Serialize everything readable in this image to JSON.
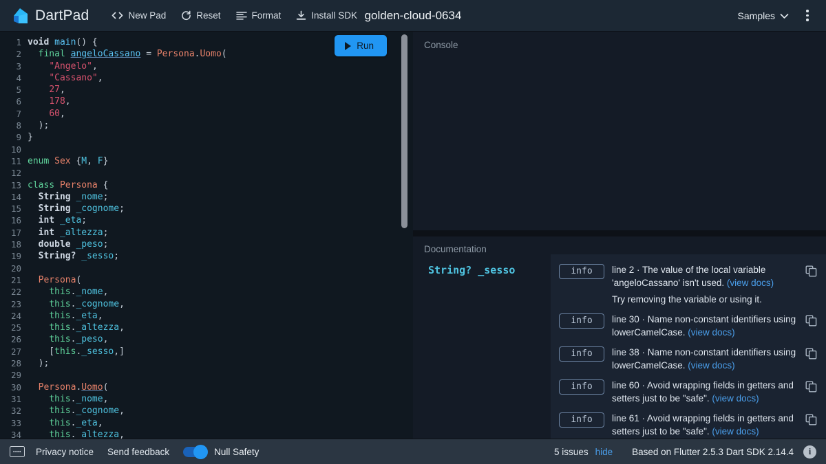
{
  "header": {
    "brand": "DartPad",
    "brand_icon": "dart-logo-icon",
    "buttons": [
      {
        "label": "New Pad",
        "icon": "code-brackets-icon"
      },
      {
        "label": "Reset",
        "icon": "refresh-icon"
      },
      {
        "label": "Format",
        "icon": "format-align-icon"
      },
      {
        "label": "Install SDK",
        "icon": "download-icon"
      }
    ],
    "pad_title": "golden-cloud-0634",
    "samples_label": "Samples",
    "samples_icon": "chevron-down-icon",
    "overflow_icon": "kebab-menu-icon"
  },
  "editor": {
    "run_label": "Run",
    "run_icon": "play-icon",
    "lines": [
      {
        "n": 1,
        "tokens": [
          {
            "t": "void ",
            "c": "kw"
          },
          {
            "t": "main",
            "c": "fn"
          },
          {
            "t": "() {",
            "c": "pun"
          }
        ]
      },
      {
        "n": 2,
        "tokens": [
          {
            "t": "  ",
            "c": "pun"
          },
          {
            "t": "final ",
            "c": "kw2"
          },
          {
            "t": "angeloCassano",
            "c": "fn un"
          },
          {
            "t": " = ",
            "c": "pun"
          },
          {
            "t": "Persona",
            "c": "typ"
          },
          {
            "t": ".",
            "c": "pun"
          },
          {
            "t": "Uomo",
            "c": "typ"
          },
          {
            "t": "(",
            "c": "pun"
          }
        ]
      },
      {
        "n": 3,
        "tokens": [
          {
            "t": "    ",
            "c": "pun"
          },
          {
            "t": "\"Angelo\"",
            "c": "str"
          },
          {
            "t": ",",
            "c": "pun"
          }
        ]
      },
      {
        "n": 4,
        "tokens": [
          {
            "t": "    ",
            "c": "pun"
          },
          {
            "t": "\"Cassano\"",
            "c": "str"
          },
          {
            "t": ",",
            "c": "pun"
          }
        ]
      },
      {
        "n": 5,
        "tokens": [
          {
            "t": "    ",
            "c": "pun"
          },
          {
            "t": "27",
            "c": "num"
          },
          {
            "t": ",",
            "c": "pun"
          }
        ]
      },
      {
        "n": 6,
        "tokens": [
          {
            "t": "    ",
            "c": "pun"
          },
          {
            "t": "178",
            "c": "num"
          },
          {
            "t": ",",
            "c": "pun"
          }
        ]
      },
      {
        "n": 7,
        "tokens": [
          {
            "t": "    ",
            "c": "pun"
          },
          {
            "t": "60",
            "c": "num"
          },
          {
            "t": ",",
            "c": "pun"
          }
        ]
      },
      {
        "n": 8,
        "tokens": [
          {
            "t": "  );",
            "c": "pun"
          }
        ]
      },
      {
        "n": 9,
        "tokens": [
          {
            "t": "}",
            "c": "pun"
          }
        ]
      },
      {
        "n": 10,
        "tokens": []
      },
      {
        "n": 11,
        "tokens": [
          {
            "t": "enum ",
            "c": "kw2"
          },
          {
            "t": "Sex ",
            "c": "typ"
          },
          {
            "t": "{",
            "c": "pun"
          },
          {
            "t": "M",
            "c": "fld"
          },
          {
            "t": ", ",
            "c": "pun"
          },
          {
            "t": "F",
            "c": "fld"
          },
          {
            "t": "}",
            "c": "pun"
          }
        ]
      },
      {
        "n": 12,
        "tokens": []
      },
      {
        "n": 13,
        "tokens": [
          {
            "t": "class ",
            "c": "kw2"
          },
          {
            "t": "Persona ",
            "c": "typ"
          },
          {
            "t": "{",
            "c": "pun"
          }
        ]
      },
      {
        "n": 14,
        "tokens": [
          {
            "t": "  ",
            "c": "pun"
          },
          {
            "t": "String",
            "c": "kw"
          },
          {
            "t": " ",
            "c": "pun"
          },
          {
            "t": "_nome",
            "c": "fld"
          },
          {
            "t": ";",
            "c": "pun"
          }
        ]
      },
      {
        "n": 15,
        "tokens": [
          {
            "t": "  ",
            "c": "pun"
          },
          {
            "t": "String",
            "c": "kw"
          },
          {
            "t": " ",
            "c": "pun"
          },
          {
            "t": "_cognome",
            "c": "fld"
          },
          {
            "t": ";",
            "c": "pun"
          }
        ]
      },
      {
        "n": 16,
        "tokens": [
          {
            "t": "  ",
            "c": "pun"
          },
          {
            "t": "int",
            "c": "kw"
          },
          {
            "t": " ",
            "c": "pun"
          },
          {
            "t": "_eta",
            "c": "fld"
          },
          {
            "t": ";",
            "c": "pun"
          }
        ]
      },
      {
        "n": 17,
        "tokens": [
          {
            "t": "  ",
            "c": "pun"
          },
          {
            "t": "int",
            "c": "kw"
          },
          {
            "t": " ",
            "c": "pun"
          },
          {
            "t": "_altezza",
            "c": "fld"
          },
          {
            "t": ";",
            "c": "pun"
          }
        ]
      },
      {
        "n": 18,
        "tokens": [
          {
            "t": "  ",
            "c": "pun"
          },
          {
            "t": "double",
            "c": "kw"
          },
          {
            "t": " ",
            "c": "pun"
          },
          {
            "t": "_peso",
            "c": "fld"
          },
          {
            "t": ";",
            "c": "pun"
          }
        ]
      },
      {
        "n": 19,
        "tokens": [
          {
            "t": "  ",
            "c": "pun"
          },
          {
            "t": "String?",
            "c": "kw"
          },
          {
            "t": " ",
            "c": "pun"
          },
          {
            "t": "_sesso",
            "c": "fld"
          },
          {
            "t": ";",
            "c": "pun"
          }
        ]
      },
      {
        "n": 20,
        "tokens": []
      },
      {
        "n": 21,
        "tokens": [
          {
            "t": "  ",
            "c": "pun"
          },
          {
            "t": "Persona",
            "c": "typ"
          },
          {
            "t": "(",
            "c": "pun"
          }
        ]
      },
      {
        "n": 22,
        "tokens": [
          {
            "t": "    ",
            "c": "pun"
          },
          {
            "t": "this",
            "c": "this"
          },
          {
            "t": ".",
            "c": "pun"
          },
          {
            "t": "_nome",
            "c": "fld"
          },
          {
            "t": ",",
            "c": "pun"
          }
        ]
      },
      {
        "n": 23,
        "tokens": [
          {
            "t": "    ",
            "c": "pun"
          },
          {
            "t": "this",
            "c": "this"
          },
          {
            "t": ".",
            "c": "pun"
          },
          {
            "t": "_cognome",
            "c": "fld"
          },
          {
            "t": ",",
            "c": "pun"
          }
        ]
      },
      {
        "n": 24,
        "tokens": [
          {
            "t": "    ",
            "c": "pun"
          },
          {
            "t": "this",
            "c": "this"
          },
          {
            "t": ".",
            "c": "pun"
          },
          {
            "t": "_eta",
            "c": "fld"
          },
          {
            "t": ",",
            "c": "pun"
          }
        ]
      },
      {
        "n": 25,
        "tokens": [
          {
            "t": "    ",
            "c": "pun"
          },
          {
            "t": "this",
            "c": "this"
          },
          {
            "t": ".",
            "c": "pun"
          },
          {
            "t": "_altezza",
            "c": "fld"
          },
          {
            "t": ",",
            "c": "pun"
          }
        ]
      },
      {
        "n": 26,
        "tokens": [
          {
            "t": "    ",
            "c": "pun"
          },
          {
            "t": "this",
            "c": "this"
          },
          {
            "t": ".",
            "c": "pun"
          },
          {
            "t": "_peso",
            "c": "fld"
          },
          {
            "t": ",",
            "c": "pun"
          }
        ]
      },
      {
        "n": 27,
        "tokens": [
          {
            "t": "    [",
            "c": "pun"
          },
          {
            "t": "this",
            "c": "this"
          },
          {
            "t": ".",
            "c": "pun"
          },
          {
            "t": "_sesso",
            "c": "fld"
          },
          {
            "t": ",]",
            "c": "pun"
          }
        ]
      },
      {
        "n": 28,
        "tokens": [
          {
            "t": "  );",
            "c": "pun"
          }
        ]
      },
      {
        "n": 29,
        "tokens": []
      },
      {
        "n": 30,
        "tokens": [
          {
            "t": "  ",
            "c": "pun"
          },
          {
            "t": "Persona",
            "c": "typ"
          },
          {
            "t": ".",
            "c": "pun"
          },
          {
            "t": "Uomo",
            "c": "typ un"
          },
          {
            "t": "(",
            "c": "pun"
          }
        ]
      },
      {
        "n": 31,
        "tokens": [
          {
            "t": "    ",
            "c": "pun"
          },
          {
            "t": "this",
            "c": "this"
          },
          {
            "t": ".",
            "c": "pun"
          },
          {
            "t": "_nome",
            "c": "fld"
          },
          {
            "t": ",",
            "c": "pun"
          }
        ]
      },
      {
        "n": 32,
        "tokens": [
          {
            "t": "    ",
            "c": "pun"
          },
          {
            "t": "this",
            "c": "this"
          },
          {
            "t": ".",
            "c": "pun"
          },
          {
            "t": "_cognome",
            "c": "fld"
          },
          {
            "t": ",",
            "c": "pun"
          }
        ]
      },
      {
        "n": 33,
        "tokens": [
          {
            "t": "    ",
            "c": "pun"
          },
          {
            "t": "this",
            "c": "this"
          },
          {
            "t": ".",
            "c": "pun"
          },
          {
            "t": "_eta",
            "c": "fld"
          },
          {
            "t": ",",
            "c": "pun"
          }
        ]
      },
      {
        "n": 34,
        "tokens": [
          {
            "t": "    ",
            "c": "pun"
          },
          {
            "t": "this",
            "c": "this"
          },
          {
            "t": ".",
            "c": "pun"
          },
          {
            "t": "_altezza",
            "c": "fld"
          },
          {
            "t": ",",
            "c": "pun"
          }
        ]
      }
    ]
  },
  "console": {
    "label": "Console",
    "output": ""
  },
  "documentation": {
    "label": "Documentation",
    "signature": "String? _sesso"
  },
  "issues": {
    "copy_icon": "copy-icon",
    "docs_link_label": "(view docs)",
    "items": [
      {
        "severity": "info",
        "message": "line 2 · The value of the local variable 'angeloCassano' isn't used.",
        "sub": "Try removing the variable or using it."
      },
      {
        "severity": "info",
        "message": "line 30 · Name non-constant identifiers using lowerCamelCase.",
        "sub": ""
      },
      {
        "severity": "info",
        "message": "line 38 · Name non-constant identifiers using lowerCamelCase.",
        "sub": ""
      },
      {
        "severity": "info",
        "message": "line 60 · Avoid wrapping fields in getters and setters just to be \"safe\".",
        "sub": ""
      },
      {
        "severity": "info",
        "message": "line 61 · Avoid wrapping fields in getters and setters just to be \"safe\".",
        "sub": ""
      }
    ]
  },
  "footer": {
    "keyboard_icon": "keyboard-icon",
    "privacy_label": "Privacy notice",
    "feedback_label": "Send feedback",
    "null_safety_label": "Null Safety",
    "null_safety_on": true,
    "issues_count_label": "5 issues",
    "hide_label": "hide",
    "version_label": "Based on Flutter 2.5.3 Dart SDK 2.14.4",
    "info_icon": "info-icon",
    "info_glyph": "i"
  },
  "colors": {
    "accent": "#2196f3",
    "link": "#4a9eea",
    "header_bg": "#1c2834",
    "editor_bg": "#101820",
    "panel_bg": "#141b26",
    "issues_bg": "#1a2331",
    "footer_bg": "#2b3642"
  }
}
